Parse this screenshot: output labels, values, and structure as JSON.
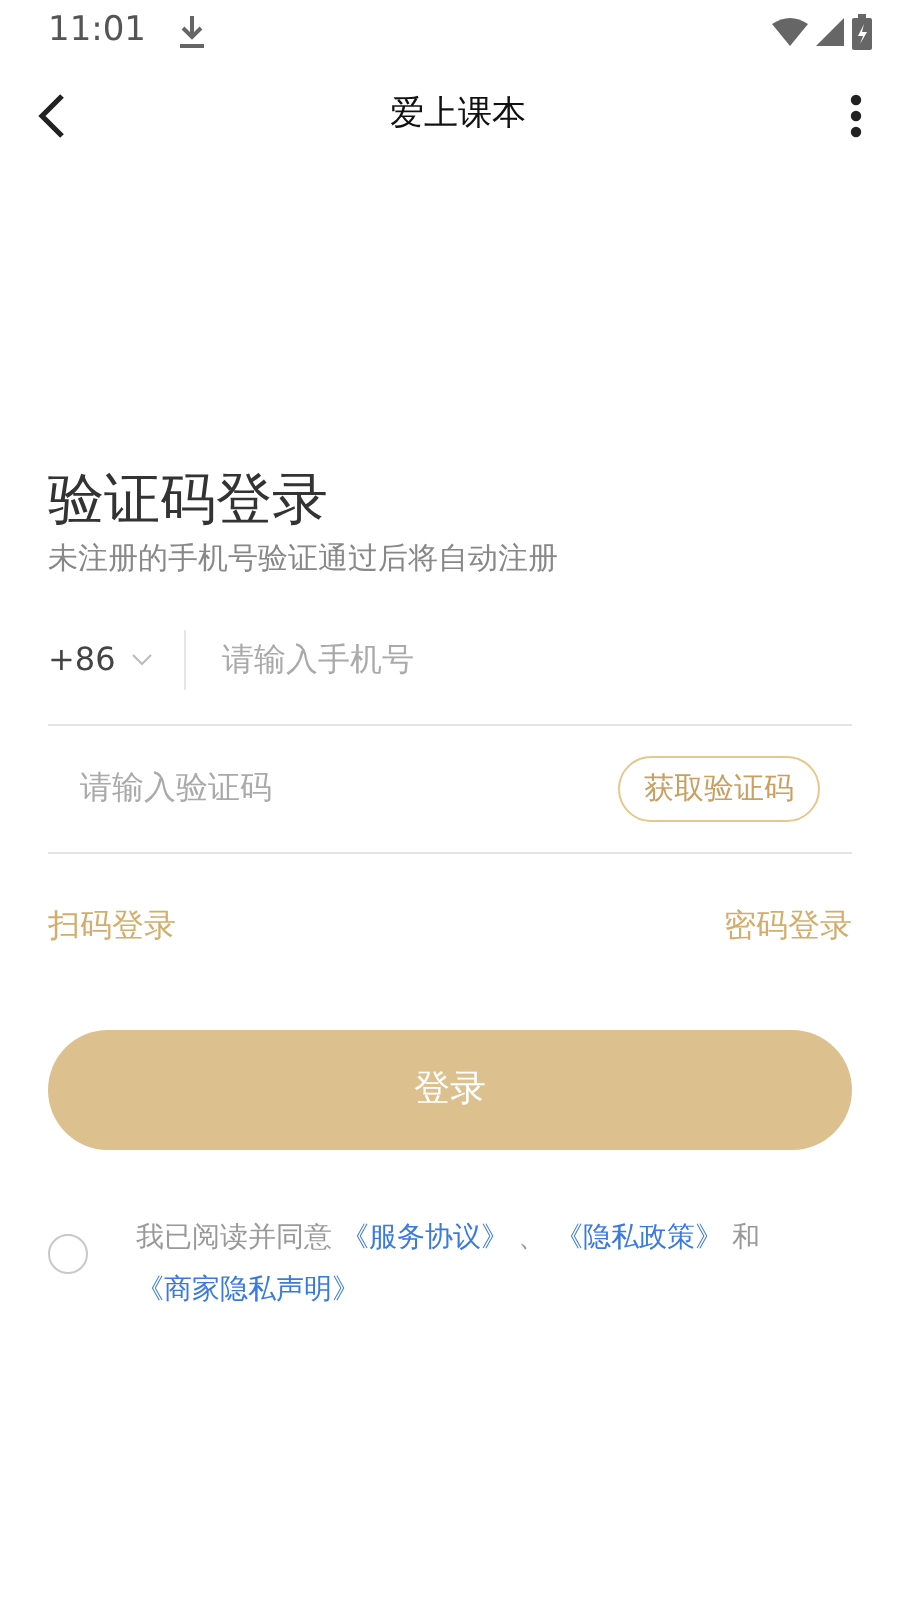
{
  "status_bar": {
    "time": "11:01"
  },
  "app_bar": {
    "title": "爱上课本"
  },
  "heading": "验证码登录",
  "subtitle": "未注册的手机号验证通过后将自动注册",
  "phone": {
    "country_code": "+86",
    "placeholder": "请输入手机号"
  },
  "code": {
    "placeholder": "请输入验证码",
    "button": "获取验证码"
  },
  "links": [
    {
      "label": "扫码登录"
    },
    {
      "label": "密码登录"
    }
  ],
  "login_button": {
    "label": "登录",
    "disabled": true
  },
  "agreement": {
    "checked": false,
    "parts": [
      {
        "kind": "text",
        "text": "我已阅读并同意"
      },
      {
        "kind": "link",
        "text": "《服务协议》"
      },
      {
        "kind": "text",
        "text": "、"
      },
      {
        "kind": "link",
        "text": "《隐私政策》"
      },
      {
        "kind": "text",
        "text": "和"
      },
      {
        "kind": "link",
        "text": "《商家隐私声明》"
      }
    ]
  }
}
